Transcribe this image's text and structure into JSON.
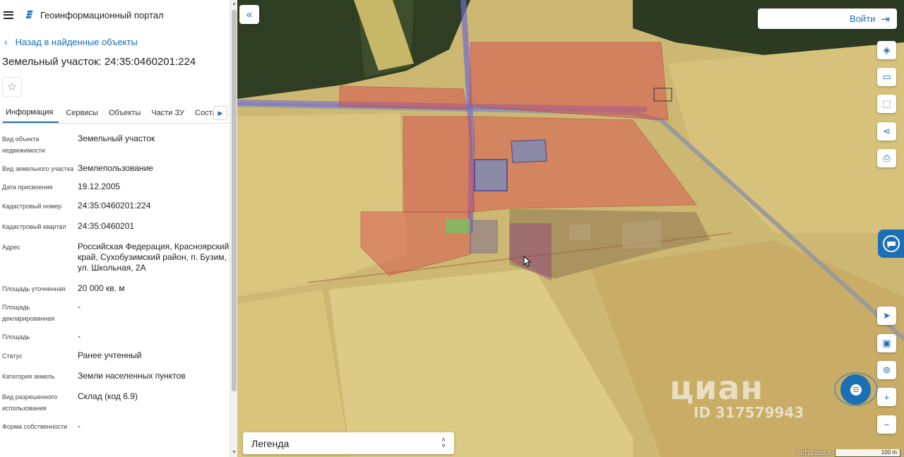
{
  "header": {
    "menu_icon": "hamburger-icon",
    "logo_icon": "portal-logo-icon",
    "title": "Геоинформационный портал"
  },
  "back_link": "Назад в найденные объекты",
  "object_title": "Земельный участок: 24:35:0460201:224",
  "tabs": [
    "Информация",
    "Сервисы",
    "Объекты",
    "Части ЗУ",
    "Соста"
  ],
  "properties": [
    {
      "label": "Вид объекта недвижимости",
      "value": "Земельный участок"
    },
    {
      "label": "Вид земельного участка",
      "value": "Землепользование"
    },
    {
      "label": "Дата присвоения",
      "value": "19.12.2005"
    },
    {
      "label": "Кадастровый номер",
      "value": "24:35:0460201:224"
    },
    {
      "label": "Кадастровый квартал",
      "value": "24:35:0460201"
    },
    {
      "label": "Адрес",
      "value": "Российская Федерация, Красноярский край, Сухобузимский район, п. Бузим, ул. Школьная, 2А"
    },
    {
      "label": "Площадь уточненная",
      "value": "20 000 кв. м"
    },
    {
      "label": "Площадь декларированная",
      "value": "-"
    },
    {
      "label": "Площадь",
      "value": "-"
    },
    {
      "label": "Статус",
      "value": "Ранее учтенный"
    },
    {
      "label": "Категория земель",
      "value": "Земли населенных пунктов"
    },
    {
      "label": "Вид разрешенного использования",
      "value": "Склад (код 6.9)"
    },
    {
      "label": "Форма собственности",
      "value": "-"
    }
  ],
  "map": {
    "login_label": "Войти",
    "legend_label": "Легенда",
    "attribution": "НСПД 2025 ©",
    "scale_label": "100 m",
    "watermark_text": "циан",
    "watermark_id": "ID 317579943",
    "colors": {
      "accent": "#1a6fb5",
      "parcel_fill": "#d9534f",
      "highlight": "#8b2a8e",
      "field": "#d8c77a"
    }
  }
}
